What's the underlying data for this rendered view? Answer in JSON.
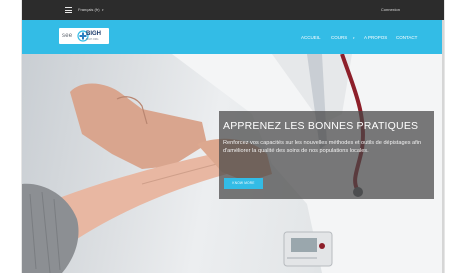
{
  "topbar": {
    "language": "Français (fr)",
    "language_caret": "▾",
    "login": "Connexion"
  },
  "brand": {
    "see_text": "see",
    "name": "BIGH",
    "tagline": "BIGH.ORG"
  },
  "nav": {
    "items": [
      "ACCUEIL",
      "COURS",
      "A PROPOS",
      "CONTACT"
    ],
    "cours_caret": "▾"
  },
  "hero": {
    "title": "APPRENEZ LES BONNES PRATIQUES",
    "text": "Renforcez vos capacités sur les nouvelles méthodes et outils de dépistages afin d'améliorer la qualité des soins de nos populations locales.",
    "button_label": "KNOW MORE"
  },
  "colors": {
    "topbar": "#2c2c2c",
    "navbar": "#33bce6",
    "accent": "#33bce6",
    "overlay": "#464646"
  }
}
